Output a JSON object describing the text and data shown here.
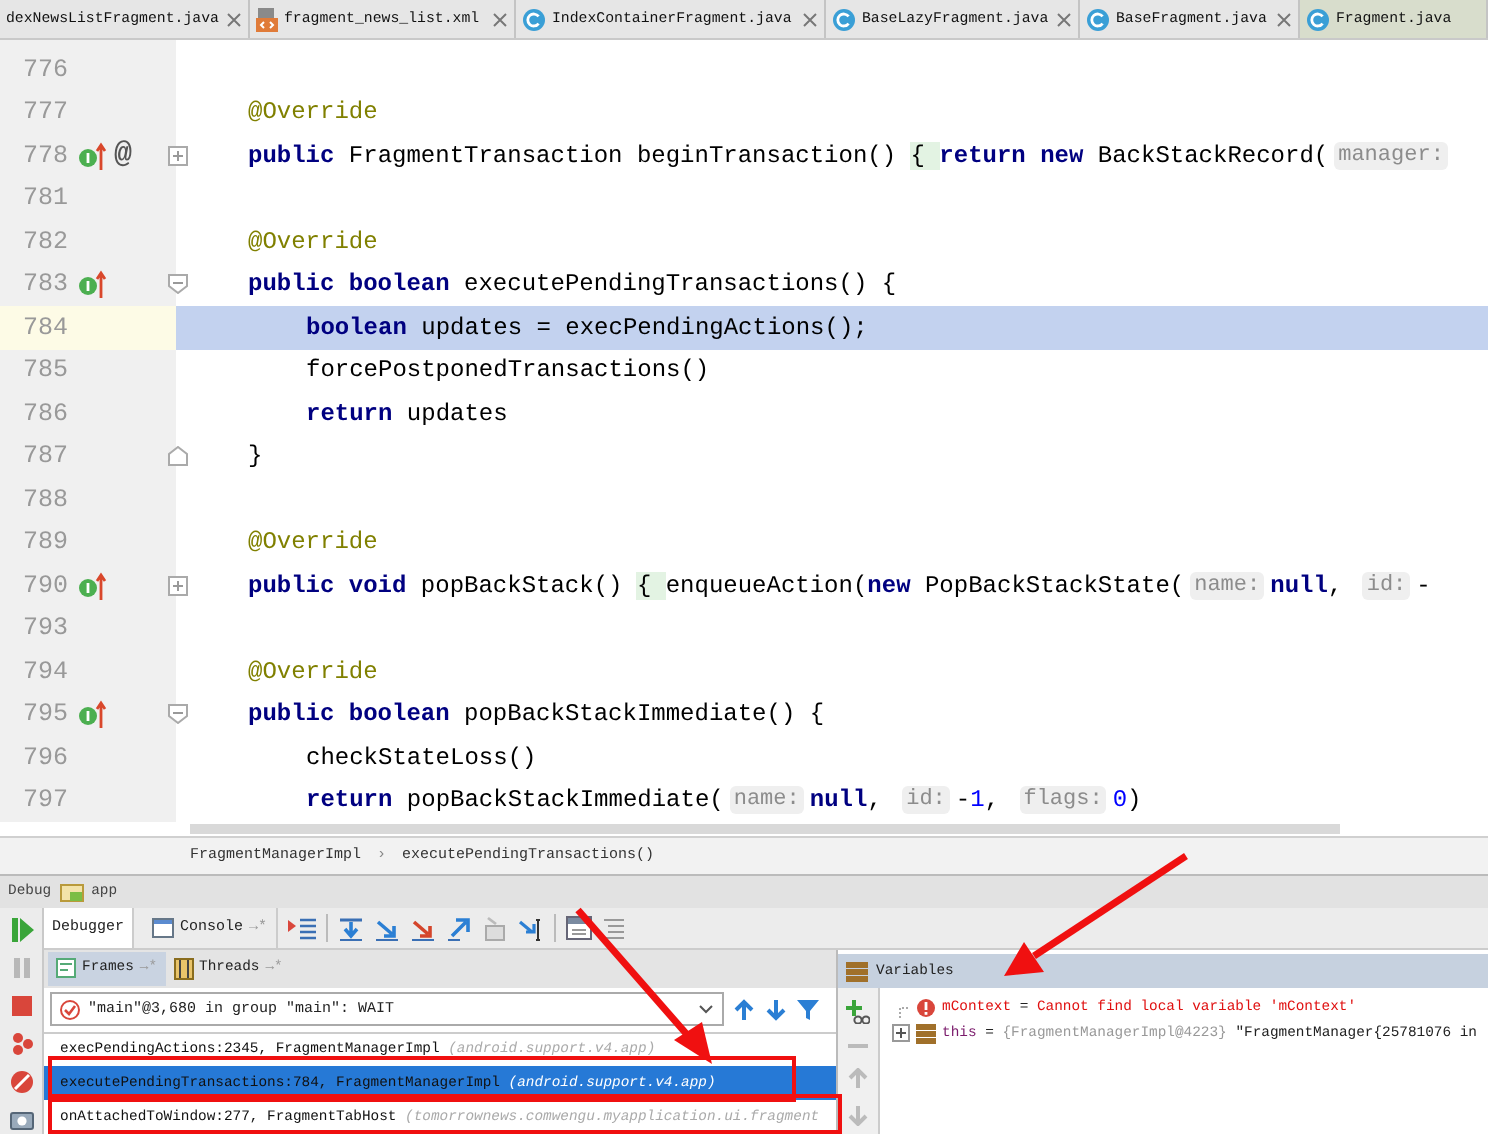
{
  "editor_tabs": [
    {
      "label": "dexNewsListFragment.java",
      "selected": false
    },
    {
      "label": "fragment_news_list.xml",
      "selected": false
    },
    {
      "label": "IndexContainerFragment.java",
      "selected": false
    },
    {
      "label": "BaseLazyFragment.java",
      "selected": false
    },
    {
      "label": "BaseFragment.java",
      "selected": false
    },
    {
      "label": "Fragment.java",
      "selected": true
    }
  ],
  "code": {
    "lines": [
      {
        "number": "776",
        "current": false
      },
      {
        "number": "777",
        "current": false,
        "kind": "member",
        "tokens": [
          {
            "kind": "annotation",
            "text": "@Override"
          }
        ]
      },
      {
        "number": "778",
        "current": false,
        "kind": "member",
        "overrides": true,
        "gutter_text": "@",
        "expanded": false,
        "tokens": [
          {
            "kind": "keyword",
            "text": "public"
          },
          {
            "kind": "plain",
            "text": " FragmentTransaction beginTransaction() "
          },
          {
            "kind": "brace",
            "text": "{ "
          },
          {
            "kind": "keyword",
            "text": "return new"
          },
          {
            "kind": "plain",
            "text": " BackStackRecord("
          },
          {
            "kind": "hint",
            "text": "manager:"
          }
        ]
      },
      {
        "number": "781",
        "current": false
      },
      {
        "number": "782",
        "current": false,
        "kind": "member",
        "tokens": [
          {
            "kind": "annotation",
            "text": "@Override"
          }
        ]
      },
      {
        "number": "783",
        "current": false,
        "kind": "member",
        "overrides": true,
        "expanded": true,
        "tokens": [
          {
            "kind": "keyword",
            "text": "public boolean"
          },
          {
            "kind": "plain",
            "text": " executePendingTransactions() {"
          }
        ]
      },
      {
        "number": "784",
        "current": true,
        "kind": "body",
        "tokens": [
          {
            "kind": "keyword",
            "text": "boolean"
          },
          {
            "kind": "plain",
            "text": " updates = execPendingActions();"
          }
        ]
      },
      {
        "number": "785",
        "current": false,
        "kind": "body",
        "tokens": [
          {
            "kind": "plain",
            "text": "forcePostponedTransactions()"
          }
        ]
      },
      {
        "number": "786",
        "current": false,
        "kind": "body",
        "tokens": [
          {
            "kind": "keyword",
            "text": "return"
          },
          {
            "kind": "plain",
            "text": " updates"
          }
        ]
      },
      {
        "number": "787",
        "current": false,
        "kind": "member",
        "fold_end": true,
        "tokens": [
          {
            "kind": "plain",
            "text": "}"
          }
        ]
      },
      {
        "number": "788",
        "current": false
      },
      {
        "number": "789",
        "current": false,
        "kind": "member",
        "tokens": [
          {
            "kind": "annotation",
            "text": "@Override"
          }
        ]
      },
      {
        "number": "790",
        "current": false,
        "kind": "member",
        "overrides": true,
        "expanded": false,
        "tokens": [
          {
            "kind": "keyword",
            "text": "public void"
          },
          {
            "kind": "plain",
            "text": " popBackStack() "
          },
          {
            "kind": "brace",
            "text": "{ "
          },
          {
            "kind": "plain",
            "text": "enqueueAction("
          },
          {
            "kind": "keyword",
            "text": "new"
          },
          {
            "kind": "plain",
            "text": " PopBackStackState("
          },
          {
            "kind": "hint",
            "text": "name:"
          },
          {
            "kind": "keyword",
            "text": "null"
          },
          {
            "kind": "plain",
            "text": ", "
          },
          {
            "kind": "hint",
            "text": "id:"
          },
          {
            "kind": "plain",
            "text": "-"
          }
        ]
      },
      {
        "number": "793",
        "current": false
      },
      {
        "number": "794",
        "current": false,
        "kind": "member",
        "tokens": [
          {
            "kind": "annotation",
            "text": "@Override"
          }
        ]
      },
      {
        "number": "795",
        "current": false,
        "kind": "member",
        "overrides": true,
        "expanded": true,
        "tokens": [
          {
            "kind": "keyword",
            "text": "public boolean"
          },
          {
            "kind": "plain",
            "text": " popBackStackImmediate() {"
          }
        ]
      },
      {
        "number": "796",
        "current": false,
        "kind": "body",
        "tokens": [
          {
            "kind": "plain",
            "text": "checkStateLoss()"
          }
        ]
      },
      {
        "number": "797",
        "current": false,
        "kind": "body",
        "tokens": [
          {
            "kind": "keyword",
            "text": "return"
          },
          {
            "kind": "plain",
            "text": " popBackStackImmediate("
          },
          {
            "kind": "hint",
            "text": "name:"
          },
          {
            "kind": "keyword",
            "text": "null"
          },
          {
            "kind": "plain",
            "text": ", "
          },
          {
            "kind": "hint",
            "text": "id:"
          },
          {
            "kind": "plain",
            "text": "-"
          },
          {
            "kind": "number",
            "text": "1"
          },
          {
            "kind": "plain",
            "text": ", "
          },
          {
            "kind": "hint",
            "text": "flags:"
          },
          {
            "kind": "number",
            "text": "0"
          },
          {
            "kind": "plain",
            "text": ")"
          }
        ]
      }
    ]
  },
  "breadcrumbs": {
    "items": [
      "FragmentManagerImpl",
      "executePendingTransactions()"
    ],
    "separator": "›"
  },
  "debug": {
    "title": "Debug",
    "configuration": "app",
    "tabs": [
      {
        "label": "Debugger",
        "selected": true
      },
      {
        "label": "Console",
        "pin": "→*",
        "selected": false
      }
    ],
    "frame_tabs": [
      {
        "label": "Frames",
        "pin": "→*",
        "selected": true
      },
      {
        "label": "Threads",
        "pin": "→*",
        "selected": false
      }
    ],
    "thread": "\"main\"@3,680 in group \"main\": WAIT",
    "frames": [
      {
        "method": "execPendingActions:2345, FragmentManagerImpl",
        "package": "(android.support.v4.app)",
        "selected": false
      },
      {
        "method": "executePendingTransactions:784, FragmentManagerImpl",
        "package": "(android.support.v4.app)",
        "selected": true
      },
      {
        "method": "onAttachedToWindow:277, FragmentTabHost",
        "package": "(tomorrownews.comwengu.myapplication.ui.fragment",
        "selected": false
      }
    ],
    "variables": {
      "title": "Variables",
      "items": [
        {
          "kind": "error",
          "name": "mContext",
          "operator": "=",
          "value": "Cannot find local variable 'mContext'"
        },
        {
          "kind": "object",
          "name": "this",
          "operator": "=",
          "type": "{FragmentManagerImpl@4223}",
          "value": "\"FragmentManager{25781076 in"
        }
      ]
    }
  }
}
